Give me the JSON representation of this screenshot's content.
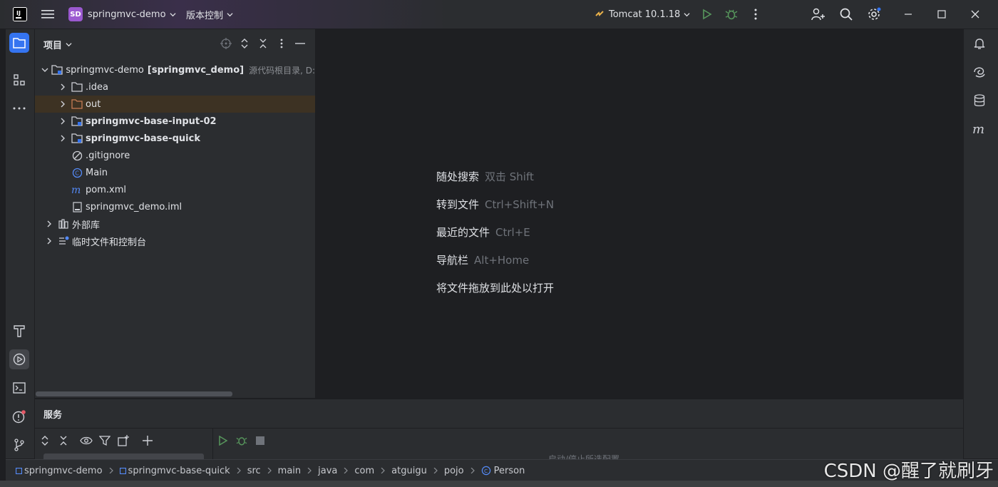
{
  "titlebar": {
    "project_badge": "SD",
    "project_name": "springmvc-demo",
    "vcs_label": "版本控制",
    "run_config": "Tomcat 10.1.18"
  },
  "project_panel": {
    "title": "项目",
    "tree": [
      {
        "label": "springmvc-demo",
        "label_bold": "[springmvc_demo]",
        "hint": "源代码根目录, D:"
      },
      {
        "label": ".idea"
      },
      {
        "label": "out"
      },
      {
        "label": "springmvc-base-input-02"
      },
      {
        "label": "springmvc-base-quick"
      },
      {
        "label": ".gitignore"
      },
      {
        "label": "Main"
      },
      {
        "label": "pom.xml"
      },
      {
        "label": "springmvc_demo.iml"
      },
      {
        "label": "外部库"
      },
      {
        "label": "临时文件和控制台"
      }
    ]
  },
  "editor": {
    "hints": [
      {
        "text": "随处搜索",
        "key": "双击 Shift"
      },
      {
        "text": "转到文件",
        "key": "Ctrl+Shift+N"
      },
      {
        "text": "最近的文件",
        "key": "Ctrl+E"
      },
      {
        "text": "导航栏",
        "key": "Alt+Home"
      },
      {
        "text": "将文件拖放到此处以打开",
        "key": ""
      }
    ]
  },
  "services": {
    "title": "服务",
    "status_text": "启动/停止所选配置"
  },
  "breadcrumb": [
    "springmvc-demo",
    "springmvc-base-quick",
    "src",
    "main",
    "java",
    "com",
    "atguigu",
    "pojo",
    "Person"
  ],
  "watermark": "CSDN @醒了就刷牙",
  "colors": {
    "accent": "#3574f0",
    "run_green": "#57965c",
    "folder_orange": "#c77d55",
    "badge_purple": "#9b59d0"
  }
}
